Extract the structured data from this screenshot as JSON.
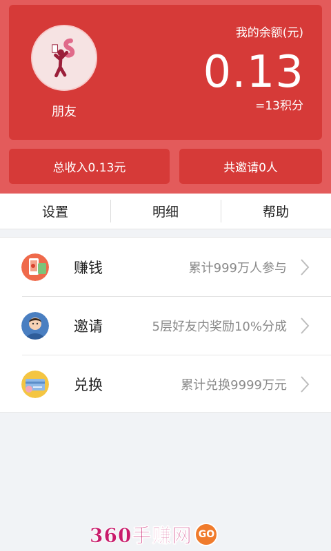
{
  "profile": {
    "nickname": "朋友",
    "avatar_icon": "money-person-icon"
  },
  "balance": {
    "label": "我的余额(元)",
    "value": "0.13",
    "points": "=13积分"
  },
  "stats": {
    "income": "总收入0.13元",
    "invites": "共邀请0人"
  },
  "tabs": [
    {
      "label": "设置"
    },
    {
      "label": "明细"
    },
    {
      "label": "帮助"
    }
  ],
  "menu": [
    {
      "title": "赚钱",
      "subtitle": "累计999万人参与",
      "icon": "earn-phone-icon"
    },
    {
      "title": "邀请",
      "subtitle": "5层好友内奖励10%分成",
      "icon": "invite-person-icon"
    },
    {
      "title": "兑换",
      "subtitle": "累计兑换9999万元",
      "icon": "cash-card-icon"
    }
  ],
  "watermark": {
    "text": "360手赚网",
    "badge": "GO"
  },
  "colors": {
    "header_bg": "#e35b5b",
    "card_bg": "#d63a38",
    "page_bg": "#f1f3f6",
    "watermark": "#c81b6b"
  }
}
